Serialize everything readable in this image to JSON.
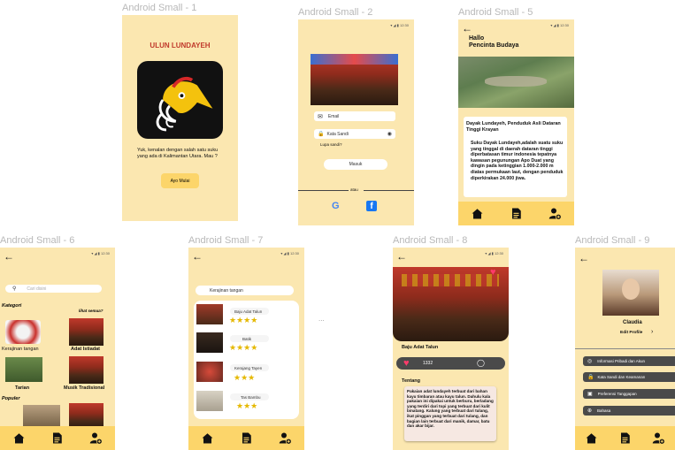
{
  "frames": {
    "f1": "Android Small - 1",
    "f2": "Android Small - 2",
    "f5": "Android Small - 5",
    "f6": "Android Small - 6",
    "f7": "Android Small - 7",
    "f8": "Android Small - 8",
    "f9": "Android Small - 9"
  },
  "ellipsis": "...",
  "screen1": {
    "title": "ULUN LUNDAYEH",
    "desc": "Yuk, kenalan dengan salah satu suku yang ada di Kalimantan Utara. Mau ?",
    "button": "Ayo Mulai"
  },
  "screen2": {
    "status": "▾ ◢ ▮ 12:30",
    "email_placeholder": "Email",
    "password_placeholder": "Kata Sandi",
    "forgot": "Lupa sandi?",
    "login": "Masuk",
    "or": "atau"
  },
  "screen5": {
    "status": "▾ ◢ ▮ 12:30",
    "greeting_line1": "Hallo",
    "greeting_line2": "Pencinta Budaya",
    "card_title": "Dayak Lundayeh, Penduduk Asli Dataran Tinggi Krayan",
    "card_body": "Suku Dayak Lundayeh,adalah suatu suku yang tinggal di daerah dataran tinggi diperbatasan timur indonesia tepatnya kawasan pegunungan Apo Duat yang dingin pada ketinggian 1.000-2.000 m diatas permukaan laut, dengan penduduk diperkirakan 24.000 jiwa."
  },
  "screen6": {
    "status": "▾ ◢ ▮ 12:30",
    "search_placeholder": "Cari disini",
    "kategori": "Kategori",
    "lihat_semua": "lihat semua?",
    "items": [
      "Kerajinan tangan",
      "Adat  Istiadat",
      "Tarian",
      "Musik Tradisional"
    ],
    "populer": "Populer"
  },
  "screen7": {
    "status": "▾ ◢ ▮ 12:30",
    "category": "Kerajinan tangan",
    "items": [
      {
        "name": "Baju Adat Talun",
        "stars": "★★★★"
      },
      {
        "name": "Batik",
        "stars": "★★★★"
      },
      {
        "name": "Kerajang Tayen",
        "stars": "★★★"
      },
      {
        "name": "Tas Bambu",
        "stars": "★★★"
      }
    ]
  },
  "screen8": {
    "status": "▾ ◢ ▮ 12:30",
    "title": "Baju Adat Talun",
    "likes": "1332",
    "tentang": "Tentang",
    "body": "Pakaian adat lundayeh terbuat dari bahan kayu timbaran atau kayu talun. Dahulu kala pakaian ini dipakai untuk berburu, berladang yang terdiri dari topi yang terbuat dari kulit binatang. Kalung yang terbuat dari tulang, ikat pinggan yang terbuat dari tulang, dan bagian lain terbuat dari manik, damar, batu dan akar bijar."
  },
  "screen9": {
    "name": "Claudia",
    "edit": "Edit Profile",
    "menu": [
      "Informasi Pribadi  dan Akun",
      "Kata Sandi dan Keamanan",
      "Preferensi Tanggapan",
      "Bahasa"
    ]
  },
  "colors": {
    "background": "#fbe7b0",
    "navbar": "#fcd56a",
    "title_red": "#c0392b"
  }
}
